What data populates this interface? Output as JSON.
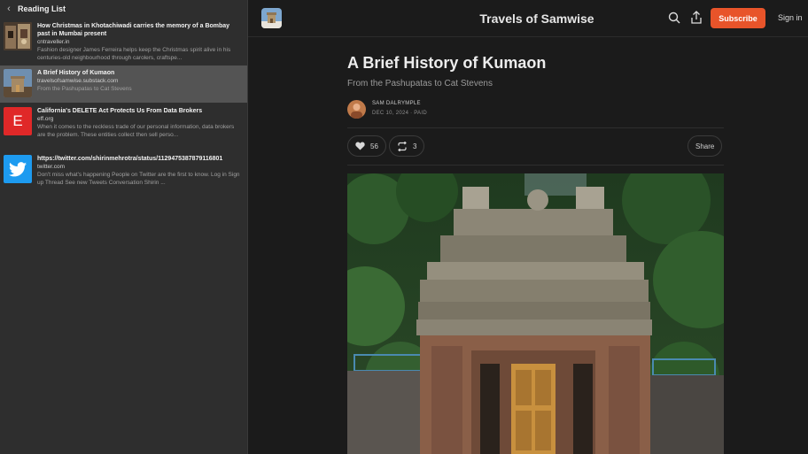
{
  "sidebar": {
    "title": "Reading List",
    "items": [
      {
        "title": "How Christmas in Khotachiwadi carries the memory of a Bombay past in Mumbai present",
        "domain": "cntraveller.in",
        "description": "Fashion designer James Ferreira helps keep the Christmas spirit alive in his centuries-old neighbourhood through carolers, craftspe...",
        "thumb": "photo"
      },
      {
        "title": "A Brief History of Kumaon",
        "domain": "travelsofsamwise.substack.com",
        "description": "From the Pashupatas to Cat Stevens",
        "thumb": "temple-logo"
      },
      {
        "title": "California's DELETE Act Protects Us From Data Brokers",
        "domain": "eff.org",
        "description": "When it comes to the reckless trade of our personal information, data brokers are the problem. These entities collect then sell perso...",
        "thumb_letter": "E",
        "thumb_color": "#e02828"
      },
      {
        "title": "https://twitter.com/shirinmehrotra/status/1129475387879116801",
        "domain": "twitter.com",
        "description": "Don't miss what's happening People on Twitter are the first to know. Log in Sign up Thread See new Tweets Conversation Shirin ...",
        "thumb": "twitter-bird-icon",
        "thumb_color": "#1d9bf0"
      }
    ]
  },
  "header": {
    "publication": "Travels of Samwise",
    "subscribe_label": "Subscribe",
    "signin_label": "Sign in"
  },
  "article": {
    "title": "A Brief History of Kumaon",
    "subtitle": "From the Pashupatas to Cat Stevens",
    "author": "SAM DALRYMPLE",
    "date": "DEC 10, 2024",
    "access": "PAID",
    "likes": "56",
    "restacks": "3",
    "share_label": "Share"
  },
  "colors": {
    "accent": "#e8542a",
    "background": "#1b1b1b",
    "sidebar": "#2e2e2e"
  }
}
